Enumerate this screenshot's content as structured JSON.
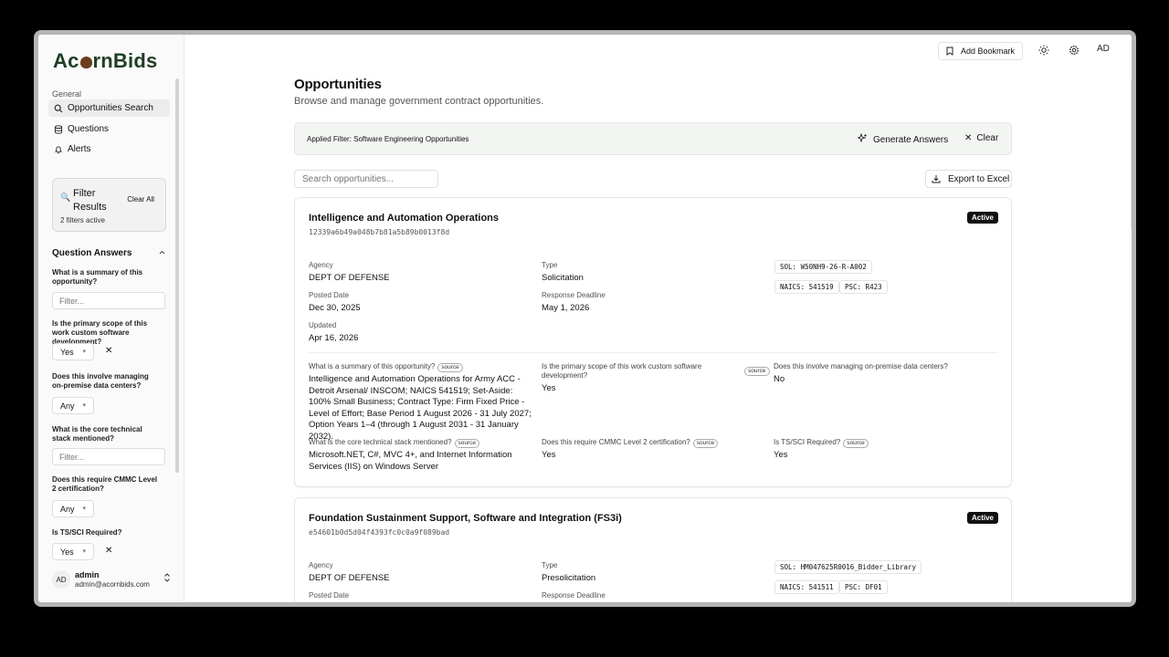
{
  "brand": {
    "name_part1": "Ac",
    "name_part2": "rnBids"
  },
  "sidebar": {
    "section_label": "General",
    "nav": [
      {
        "label": "Opportunities Search",
        "icon": "search-icon"
      },
      {
        "label": "Questions",
        "icon": "database-icon"
      },
      {
        "label": "Alerts",
        "icon": "bell-icon"
      }
    ],
    "filter_box": {
      "title": "Filter Results",
      "clear_label": "Clear All",
      "count_text": "2 filters active"
    },
    "question_answers": {
      "title": "Question Answers",
      "questions": [
        {
          "label": "What is a summary of this opportunity?",
          "control": "input",
          "placeholder": "Filter..."
        },
        {
          "label": "Is the primary scope of this work custom software development?",
          "control": "select",
          "value": "Yes",
          "clearable": true
        },
        {
          "label": "Does this involve managing on-premise data centers?",
          "control": "select",
          "value": "Any",
          "clearable": false
        },
        {
          "label": "What is the core technical stack mentioned?",
          "control": "input",
          "placeholder": "Filter..."
        },
        {
          "label": "Does this require CMMC Level 2 certification?",
          "control": "select",
          "value": "Any",
          "clearable": false
        },
        {
          "label": "Is TS/SCI Required?",
          "control": "select",
          "value": "Yes",
          "clearable": true
        }
      ]
    },
    "user": {
      "initials": "AD",
      "name": "admin",
      "email": "admin@acornbids.com"
    }
  },
  "topbar": {
    "bookmark_label": "Add Bookmark",
    "avatar_initials": "AD"
  },
  "page": {
    "title": "Opportunities",
    "subtitle": "Browse and manage government contract opportunities."
  },
  "filter_bar": {
    "applied_text": "Applied Filter: Software Engineering Opportunities",
    "generate_label": "Generate Answers",
    "clear_label": "Clear"
  },
  "search": {
    "placeholder": "Search opportunities..."
  },
  "export_label": "Export to Excel",
  "labels": {
    "agency": "Agency",
    "type": "Type",
    "posted": "Posted Date",
    "deadline": "Response Deadline",
    "updated": "Updated",
    "source": "source"
  },
  "opportunities": [
    {
      "title": "Intelligence and Automation Operations",
      "id": "12339a6b49a048b7b81a5b89b0013f8d",
      "status": "Active",
      "agency": "DEPT OF DEFENSE",
      "type": "Solicitation",
      "posted": "Dec 30, 2025",
      "deadline": "May 1, 2026",
      "updated": "Apr 16, 2026",
      "sol": "SOL: W50NH9-26-R-A002",
      "naics": "NAICS: 541519",
      "psc": "PSC: R423",
      "answers": [
        {
          "q": "What is a summary of this opportunity?",
          "a": "Intelligence and Automation Operations for Army ACC - Detroit Arsenal/ INSCOM; NAICS 541519; Set-Aside: 100% Small Business; Contract Type: Firm Fixed Price - Level of Effort; Base Period 1 August 2026 - 31 July 2027; Option Years 1–4 (through 1 August 2031 - 31 January 2032)."
        },
        {
          "q": "Is the primary scope of this work custom software development?",
          "a": "Yes"
        },
        {
          "q": "Does this involve managing on-premise data centers?",
          "a": "No"
        },
        {
          "q": "What is the core technical stack mentioned?",
          "a": "Microsoft.NET, C#, MVC 4+, and Internet Information Services (IIS) on Windows Server"
        },
        {
          "q": "Does this require CMMC Level 2 certification?",
          "a": "Yes"
        },
        {
          "q": "Is TS/SCI Required?",
          "a": "Yes"
        }
      ]
    },
    {
      "title": "Foundation Sustainment Support, Software and Integration (FS3i)",
      "id": "e54601b0d5d04f4393fc0c0a9f089bad",
      "status": "Active",
      "agency": "DEPT OF DEFENSE",
      "type": "Presolicitation",
      "sol": "SOL: HM047625R0016_Bidder_Library",
      "naics": "NAICS: 541511",
      "psc": "PSC: DF01"
    }
  ]
}
